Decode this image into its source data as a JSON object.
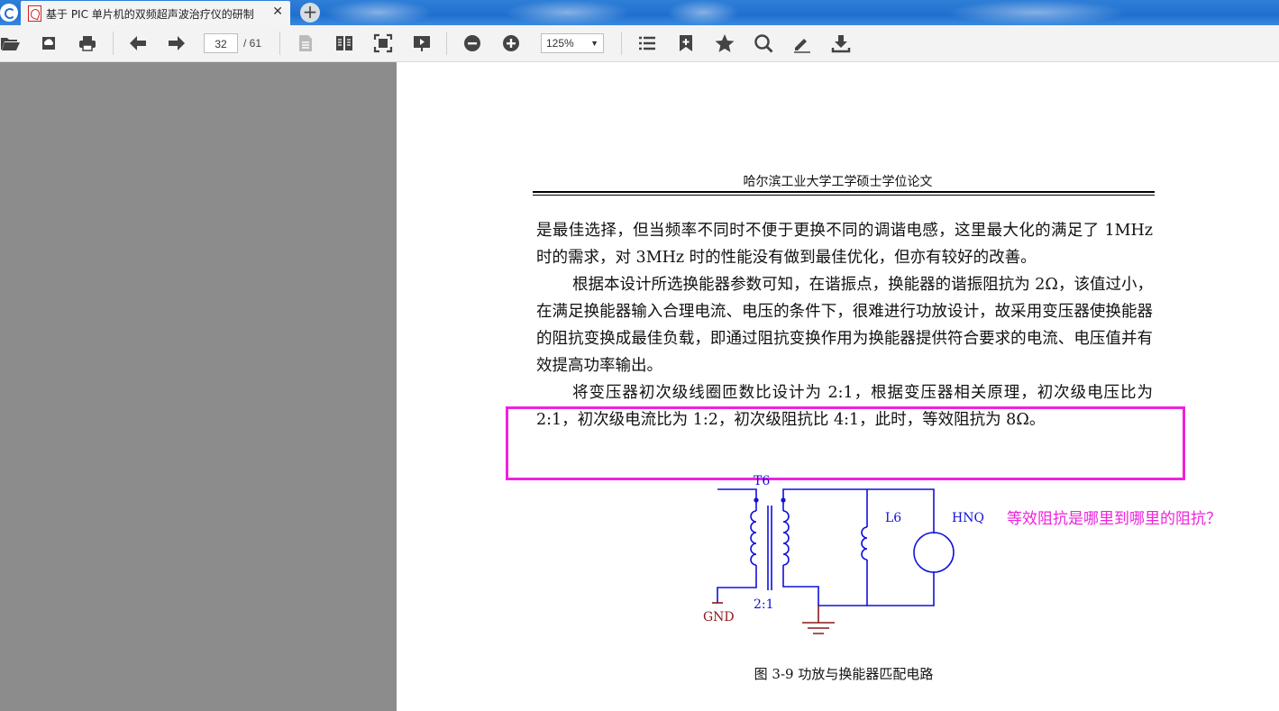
{
  "tab": {
    "title": "基于 PIC 单片机的双频超声波治疗仪的研制",
    "close": "✕",
    "new_tab": "+"
  },
  "toolbar": {
    "icons": [
      "open-folder-icon",
      "cloud-save-icon",
      "print-icon",
      "previous-page-icon",
      "next-page-icon",
      "single-page-icon",
      "two-page-icon",
      "fit-page-icon",
      "presentation-icon",
      "zoom-out-icon",
      "zoom-in-icon",
      "outline-icon",
      "add-bookmark-icon",
      "favorite-star-icon",
      "search-icon",
      "annotate-pen-icon",
      "download-icon"
    ],
    "page_current": "32",
    "page_total": "/ 61",
    "zoom": "125%"
  },
  "document": {
    "running_header": "哈尔滨工业大学工学硕士学位论文",
    "para1": "是最佳选择，但当频率不同时不便于更换不同的调谐电感，这里最大化的满足了 1MHz 时的需求，对 3MHz 时的性能没有做到最佳优化，但亦有较好的改善。",
    "para2": "根据本设计所选换能器参数可知，在谐振点，换能器的谐振阻抗为 2Ω，该值过小，在满足换能器输入合理电流、电压的条件下，很难进行功放设计，故采用变压器使换能器的阻抗变换成最佳负载，即通过阻抗变换作用为换能器提供符合要求的电流、电压值并有效提高功率输出。",
    "para3": "将变压器初次级线圈匝数比设计为 2:1，根据变压器相关原理，初次级电压比为 2:1，初次级电流比为 1:2，初次级阻抗比 4:1，此时，等效阻抗为 8Ω。",
    "figure": {
      "label_t6": "T6",
      "label_l6": "L6",
      "label_hnq": "HNQ",
      "label_ratio": "2:1",
      "label_gnd": "GND",
      "caption": "图 3-9  功放与换能器匹配电路"
    },
    "annotation": "等效阻抗是哪里到哪里的阻抗？"
  },
  "colors": {
    "circuit_blue": "#1010dd",
    "ground_red": "#8b1a1a",
    "annotation_magenta": "#ee22dd"
  }
}
